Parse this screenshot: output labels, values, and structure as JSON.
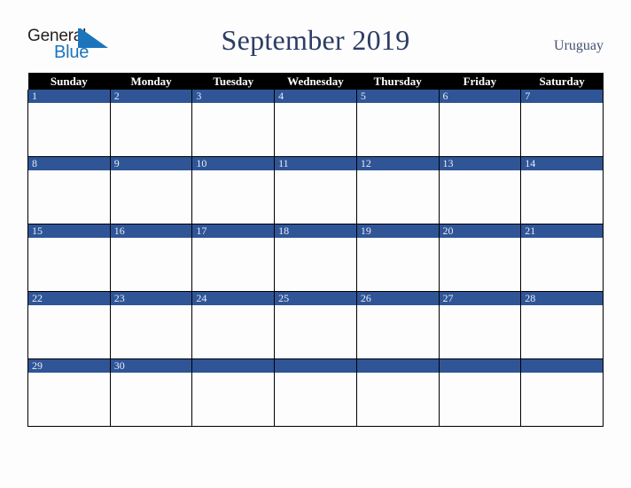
{
  "header": {
    "logo": {
      "text_primary": "General",
      "text_secondary": "Blue",
      "mark_icon": "blue-triangle-flag-icon",
      "color_primary": "#231f20",
      "color_secondary": "#1c75bc"
    },
    "title": "September 2019",
    "country": "Uruguay"
  },
  "calendar": {
    "month": "September",
    "year": "2019",
    "accent_color": "#2f5597",
    "header_bg_color": "#000000",
    "weekday_headers": [
      "Sunday",
      "Monday",
      "Tuesday",
      "Wednesday",
      "Thursday",
      "Friday",
      "Saturday"
    ],
    "weeks": [
      [
        {
          "day": "1",
          "events": ""
        },
        {
          "day": "2",
          "events": ""
        },
        {
          "day": "3",
          "events": ""
        },
        {
          "day": "4",
          "events": ""
        },
        {
          "day": "5",
          "events": ""
        },
        {
          "day": "6",
          "events": ""
        },
        {
          "day": "7",
          "events": ""
        }
      ],
      [
        {
          "day": "8",
          "events": ""
        },
        {
          "day": "9",
          "events": ""
        },
        {
          "day": "10",
          "events": ""
        },
        {
          "day": "11",
          "events": ""
        },
        {
          "day": "12",
          "events": ""
        },
        {
          "day": "13",
          "events": ""
        },
        {
          "day": "14",
          "events": ""
        }
      ],
      [
        {
          "day": "15",
          "events": ""
        },
        {
          "day": "16",
          "events": ""
        },
        {
          "day": "17",
          "events": ""
        },
        {
          "day": "18",
          "events": ""
        },
        {
          "day": "19",
          "events": ""
        },
        {
          "day": "20",
          "events": ""
        },
        {
          "day": "21",
          "events": ""
        }
      ],
      [
        {
          "day": "22",
          "events": ""
        },
        {
          "day": "23",
          "events": ""
        },
        {
          "day": "24",
          "events": ""
        },
        {
          "day": "25",
          "events": ""
        },
        {
          "day": "26",
          "events": ""
        },
        {
          "day": "27",
          "events": ""
        },
        {
          "day": "28",
          "events": ""
        }
      ],
      [
        {
          "day": "29",
          "events": ""
        },
        {
          "day": "30",
          "events": ""
        },
        {
          "day": "",
          "events": ""
        },
        {
          "day": "",
          "events": ""
        },
        {
          "day": "",
          "events": ""
        },
        {
          "day": "",
          "events": ""
        },
        {
          "day": "",
          "events": ""
        }
      ]
    ]
  }
}
